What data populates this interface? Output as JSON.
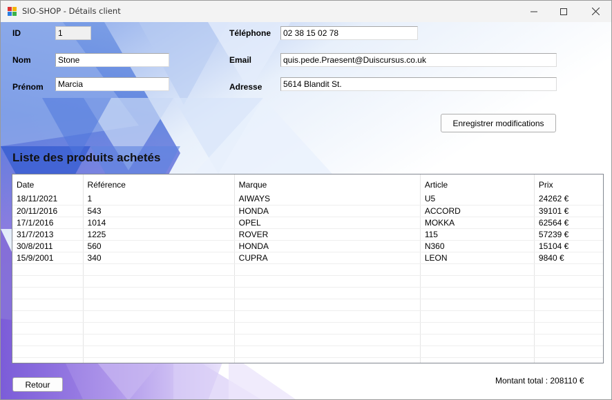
{
  "window": {
    "title": "SIO-SHOP - Détails client"
  },
  "form": {
    "id_label": "ID",
    "id_value": "1",
    "nom_label": "Nom",
    "nom_value": "Stone",
    "prenom_label": "Prénom",
    "prenom_value": "Marcia",
    "telephone_label": "Téléphone",
    "telephone_value": "02 38 15 02 78",
    "email_label": "Email",
    "email_value": "quis.pede.Praesent@Duiscursus.co.uk",
    "adresse_label": "Adresse",
    "adresse_value": "5614 Blandit St.",
    "save_label": "Enregistrer modifications"
  },
  "products": {
    "title": "Liste des produits achetés",
    "columns": [
      "Date",
      "Référence",
      "Marque",
      "Article",
      "Prix"
    ],
    "rows": [
      [
        "18/11/2021",
        "1",
        "AIWAYS",
        "U5",
        "24262 €"
      ],
      [
        "20/11/2016",
        "543",
        "HONDA",
        "ACCORD",
        "39101 €"
      ],
      [
        "17/1/2016",
        "1014",
        "OPEL",
        "MOKKA",
        "62564 €"
      ],
      [
        "31/7/2013",
        "1225",
        "ROVER",
        "115",
        "57239 €"
      ],
      [
        "30/8/2011",
        "560",
        "HONDA",
        "N360",
        "15104 €"
      ],
      [
        "15/9/2001",
        "340",
        "CUPRA",
        "LEON",
        "9840 €"
      ]
    ]
  },
  "footer": {
    "back_label": "Retour",
    "total_text": "Montant total : 208110 €"
  },
  "colors": {
    "titlebar": "#f3f3f3",
    "bg_blue": "#3d63d8",
    "bg_purple": "#7a5ad8"
  }
}
